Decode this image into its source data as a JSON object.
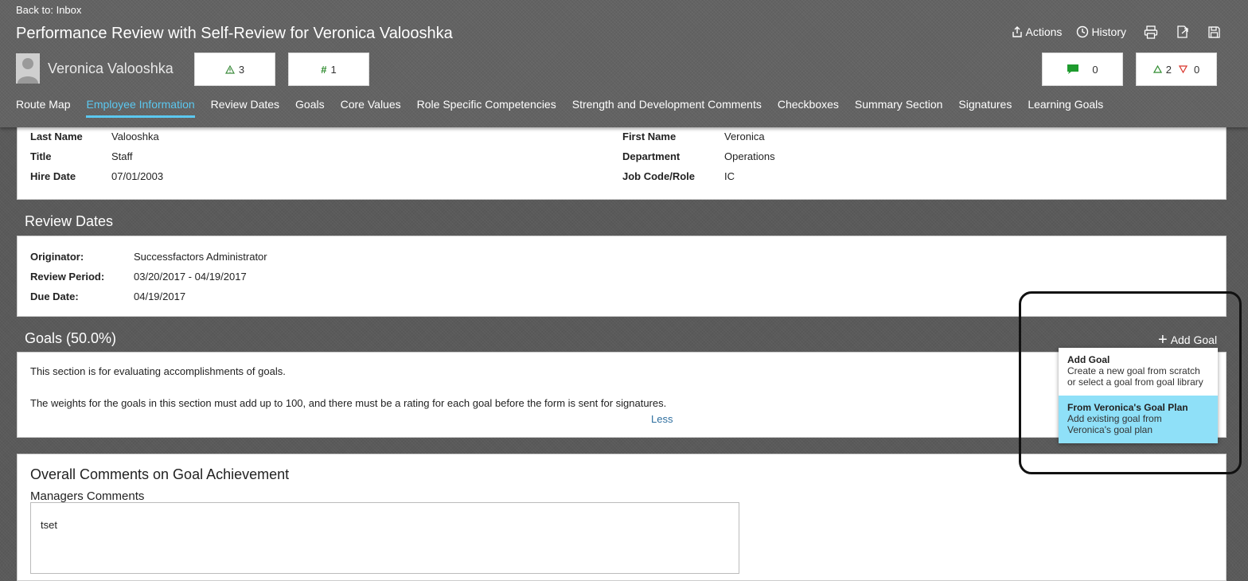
{
  "header": {
    "back_link": "Back to: Inbox",
    "title": "Performance Review with Self-Review for Veronica Valooshka",
    "actions_label": "Actions",
    "history_label": "History",
    "employee_name": "Veronica Valooshka",
    "warnings_count": "3",
    "hash_count": "1",
    "comments_count": "0",
    "up_count": "2",
    "down_count": "0"
  },
  "tabs": [
    {
      "label": "Route Map"
    },
    {
      "label": "Employee Information"
    },
    {
      "label": "Review Dates"
    },
    {
      "label": "Goals"
    },
    {
      "label": "Core Values"
    },
    {
      "label": "Role Specific Competencies"
    },
    {
      "label": "Strength and Development Comments"
    },
    {
      "label": "Checkboxes"
    },
    {
      "label": "Summary Section"
    },
    {
      "label": "Signatures"
    },
    {
      "label": "Learning Goals"
    }
  ],
  "employee_info": {
    "last_name_label": "Last Name",
    "last_name": "Valooshka",
    "title_label": "Title",
    "title": "Staff",
    "hire_date_label": "Hire Date",
    "hire_date": "07/01/2003",
    "first_name_label": "First Name",
    "first_name": "Veronica",
    "department_label": "Department",
    "department": "Operations",
    "job_code_label": "Job Code/Role",
    "job_code": "IC"
  },
  "review_dates": {
    "heading": "Review Dates",
    "originator_label": "Originator:",
    "originator": "Successfactors Administrator",
    "period_label": "Review Period:",
    "period": "03/20/2017 - 04/19/2017",
    "due_label": "Due Date:",
    "due": "04/19/2017"
  },
  "goals": {
    "heading": "Goals (50.0%)",
    "add_goal_label": "Add Goal",
    "desc_line1": "This section is for evaluating accomplishments of goals.",
    "desc_line2": "The weights for the goals in this section must add up to 100, and there must be a rating for each goal before the form is sent for signatures.",
    "less_link": "Less",
    "menu": [
      {
        "title": "Add Goal",
        "line1": "Create a new goal from scratch",
        "line2": "or select a goal from goal library"
      },
      {
        "title": "From Veronica's Goal Plan",
        "line1": "Add existing goal from",
        "line2": "Veronica's goal plan"
      }
    ]
  },
  "overall_comments": {
    "heading": "Overall Comments on Goal Achievement",
    "managers_label": "Managers Comments",
    "managers_value": "tset"
  },
  "colors": {
    "accent": "#5bc8f0",
    "menu_selected": "#8fe0f8",
    "header_bg": "#636363",
    "link": "#2f6f9f"
  }
}
